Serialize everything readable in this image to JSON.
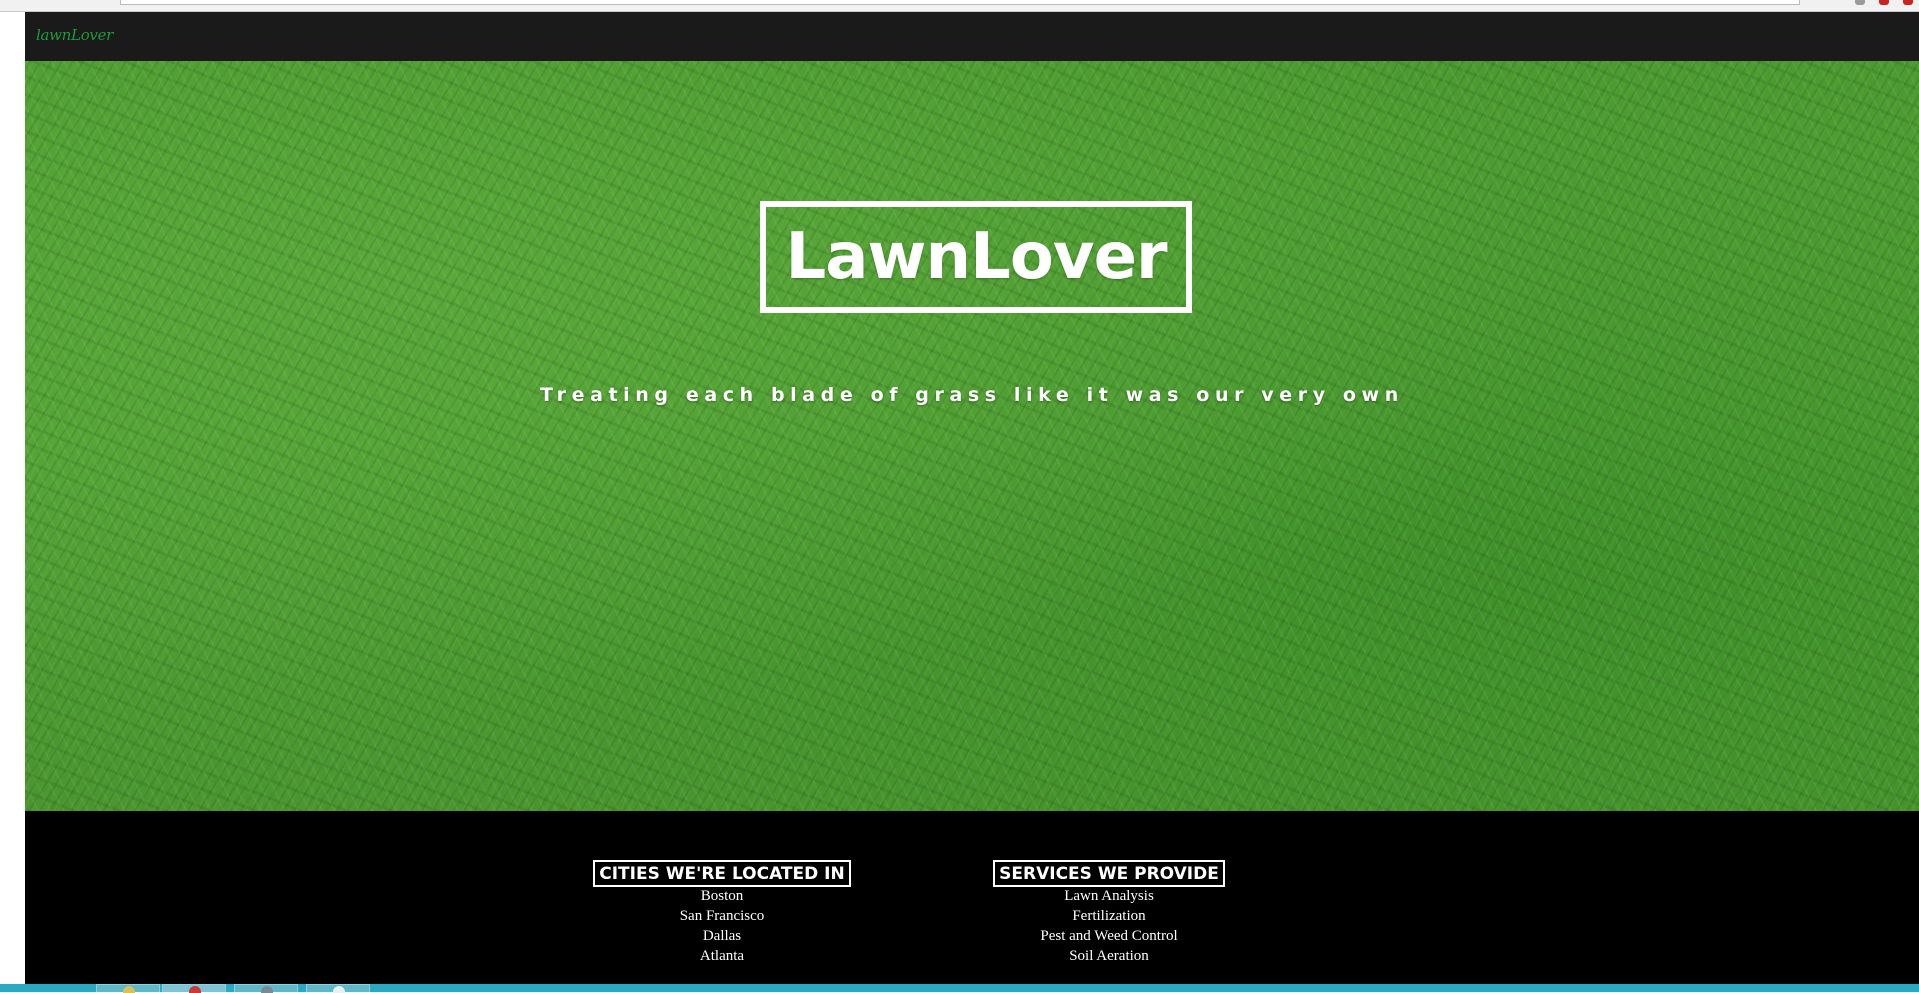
{
  "navbar": {
    "brand": "lawnLover"
  },
  "hero": {
    "title": "LawnLover",
    "tagline": "Treating each blade of grass like it was our very own"
  },
  "footer": {
    "cities": {
      "heading": "CITIES WE'RE LOCATED IN",
      "items": [
        "Boston",
        "San Francisco",
        "Dallas",
        "Atlanta"
      ]
    },
    "services": {
      "heading": "SERVICES WE PROVIDE",
      "items": [
        "Lawn Analysis",
        "Fertilization",
        "Pest and Weed Control",
        "Soil Aeration"
      ]
    }
  },
  "colors": {
    "navbar_bg": "#1a1a1a",
    "brand": "#1d9b3a",
    "footer_bg": "#000000",
    "taskbar": "#2aa9c2"
  }
}
